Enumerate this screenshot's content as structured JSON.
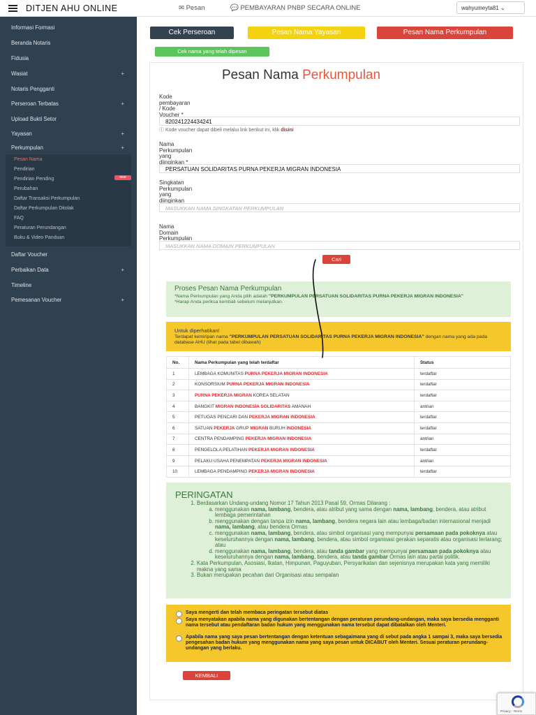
{
  "header": {
    "brand": "DITJEN AHU ONLINE",
    "pesan": "✉ Pesan",
    "pnbp": "💬 PEMBAYARAN PNBP SECARA ONLINE",
    "user": "wahyumeyta81 ⌄"
  },
  "sidebar": {
    "items": [
      {
        "label": "Informasi Formasi",
        "plus": ""
      },
      {
        "label": "Beranda Notaris",
        "plus": ""
      },
      {
        "label": "Fidusia",
        "plus": ""
      },
      {
        "label": "Wasiat",
        "plus": "+"
      },
      {
        "label": "Notaris Pengganti",
        "plus": ""
      },
      {
        "label": "Perseroan Terbatas",
        "plus": "+"
      },
      {
        "label": "Upload Bukti Setor",
        "plus": ""
      },
      {
        "label": "Yayasan",
        "plus": "+"
      },
      {
        "label": "Perkumpulan",
        "plus": "+"
      }
    ],
    "sub": [
      "Pesan Nama",
      "Pendirian",
      "Pendirian Pending",
      "Perubahan",
      "Daftar Transaksi Perkumpulan",
      "Daftar Perkumpulan Ditolak",
      "FAQ",
      "Peraturan Perundangan",
      "Buku & Video Panduan"
    ],
    "new_badge": "new",
    "bottom": [
      {
        "label": "Daftar Voucher",
        "plus": ""
      },
      {
        "label": "Perbaikan Data",
        "plus": "+"
      },
      {
        "label": "Timeline",
        "plus": ""
      },
      {
        "label": "Pemesanan Voucher",
        "plus": "+"
      }
    ]
  },
  "buttons": {
    "cek": "Cek Perseroan",
    "yayasan": "Pesan Nama Yayasan",
    "perkumpulan": "Pesan Nama Perkumpulan",
    "ceknama": "Cek nama yang telah dipesan",
    "cari": "Cari",
    "kembali": "KEMBALI"
  },
  "form": {
    "title_a": "Pesan Nama",
    "title_b": "Perkumpulan",
    "voucher_label": "Kode\npembayaran\n/ Kode\nVoucher *",
    "voucher_value": "820241224434241",
    "voucher_help": "Kode voucher dapat dibeli melalui link berikut ini, klik",
    "voucher_link": "disini",
    "nama_label": "Nama\nPerkumpulan\nyang\ndiinginkan *",
    "nama_value": "PERSATUAN SOLIDARITAS PURNA PEKERJA MIGRAN INDONESIA",
    "singkatan_label": "Singkatan\nPerkumpulan\nyang\ndiinginkan",
    "singkatan_placeholder": "MASUKKAN NAMA SINGKATAN PERKUMPULAN",
    "domain_label": "Nama\nDomain\nPerkumpulan",
    "domain_placeholder": "MASUKKAN NAMA DOMAIN PERKUMPULAN"
  },
  "proses": {
    "title": "Proses Pesan Nama Perkumpulan",
    "line1": "*Nama Perkumpulan yang Anda pilih adalah",
    "line1_name": "\"PERKUMPULAN PERSATUAN SOLIDARITAS PURNA PEKERJA MIGRAN INDONESIA\"",
    "line2": "*Harap Anda periksa kembali sebelum melanjutkan."
  },
  "perhatian": {
    "title": "Untuk diperhatikan!",
    "pre": "Terdapat kemiripan nama",
    "name": "\"PERKUMPULAN PERSATUAN SOLIDARITAS PURNA PEKERJA MIGRAN INDONESIA\"",
    "post": "dengan nama yang ada pada database AHU (lihat pada tabel dibawah)"
  },
  "table": {
    "headers": [
      "No.",
      "Nama Perkumpulan yang telah terdaftar",
      "Status"
    ],
    "rows": [
      {
        "no": "1",
        "parts": [
          [
            "LEMBAGA KOMUNITAS ",
            0
          ],
          [
            "PURNA PEKERJA MIGRAN INDONESIA",
            1
          ]
        ],
        "status": "terdaftar"
      },
      {
        "no": "2",
        "parts": [
          [
            "KONSORSIUM ",
            0
          ],
          [
            "PURNA PEKERJA MIGRAN INDONESIA",
            1
          ]
        ],
        "status": "terdaftar"
      },
      {
        "no": "3",
        "parts": [
          [
            "PURNA PEKERJA MIGRAN",
            1
          ],
          [
            " KOREA SELATAN",
            0
          ]
        ],
        "status": "terdaftar"
      },
      {
        "no": "4",
        "parts": [
          [
            "BANGKIT ",
            0
          ],
          [
            "MIGRAN INDONESIA SOLIDARITAS",
            1
          ],
          [
            " AMANAH",
            0
          ]
        ],
        "status": "antrian"
      },
      {
        "no": "5",
        "parts": [
          [
            "PETUGAS PENCARI DAN ",
            0
          ],
          [
            "PEKERJA MIGRAN INDONESIA",
            1
          ]
        ],
        "status": "terdaftar"
      },
      {
        "no": "6",
        "parts": [
          [
            "SATUAN ",
            0
          ],
          [
            "PEKERJA",
            1
          ],
          [
            " GRUP ",
            0
          ],
          [
            "MIGRAN",
            1
          ],
          [
            " BURUH ",
            0
          ],
          [
            "INDONESIA",
            1
          ]
        ],
        "status": "terdaftar"
      },
      {
        "no": "7",
        "parts": [
          [
            "CENTRA PENDAMPING ",
            0
          ],
          [
            "PEKERJA MIGRAN INDONESIA",
            1
          ]
        ],
        "status": "antrian"
      },
      {
        "no": "8",
        "parts": [
          [
            "PENGELOLA PELATIHAN ",
            0
          ],
          [
            "PEKERJA MIGRAN INDONESIA",
            1
          ]
        ],
        "status": "terdaftar"
      },
      {
        "no": "9",
        "parts": [
          [
            "PELAKU USAHA PENEMPATAN ",
            0
          ],
          [
            "PEKERJA MIGRAN INDONESIA",
            1
          ]
        ],
        "status": "antrian"
      },
      {
        "no": "10",
        "parts": [
          [
            "LEMBAGA PENDAMPING ",
            0
          ],
          [
            "PEKERJA MIGRAN INDONESIA",
            1
          ]
        ],
        "status": "terdaftar"
      }
    ]
  },
  "peringatan": {
    "title": "PERINGATAN",
    "items": [
      {
        "html": "Berdasarkan Undang-undang Nomor 17 Tahun 2013 Pasal 59, Ormas Dilarang :",
        "sub": [
          "menggunakan <b>nama, lambang</b>, bendera, atau atribut yang sama dengan <b>nama, lambang</b>, bendera, atau atribut lembaga pemerintahan",
          "menggunakan dengan tanpa izin <b>nama, lambang</b>, bendera negara lain atau lembaga/badan internasional menjadi <b>nama, lambang</b>, atau bendera Ormas",
          "menggunakan <b>nama, lambang</b>, bendera, atau simbol organisasi yang mempunyai <b>persamaan pada pokoknya</b> atau keseluruhannya dengan <b>nama, lambang</b>, bendera, atau simbol organisasi gerakan separatis atau organisasi terlarang; atau",
          "menggunakan <b>nama, lambang</b>, bendera, atau <b>tanda gambar</b> yang mempunyai <b>persamaan pada pokoknya</b> atau keseluruhannya dengan <b>nama, lambang</b>, bendera, atau <b>tanda gambar</b> Ormas lain atau partai politik."
        ]
      },
      {
        "html": "Kata Perkumpulan, Asosiasi, Ikatan, Himpunan, Paguyuban, Persyarikatan dan sejenisnya merupakan kata yang memiliki makna yang sama",
        "sub": []
      },
      {
        "html": "Bukan merupakan pecahan dari Organisasi atau sempalan",
        "sub": []
      }
    ]
  },
  "agreements": [
    "Saya mengerti dan telah membaca peringatan tersebut diatas",
    "Saya menyatakan apabila nama yang digunakan bertentangan dengan peraturan perundang-undangan, maka saya bersedia mengganti nama tersebut atau pendaftaran badan hukum yang menggunakan nama tersebut dapat dibatalkan oleh Menteri.",
    "Apabila nama yang saya pesan bertentangan dengan ketentuan sebagaimana yang di sebut pada angka 1 sampai 3, maka saya bersedia pengesahan badan hukum yang menggunakan nama yang saya pesan untuk DICABUT oleh Menteri. Sesuai peraturan perundang-undangan yang berlaku."
  ],
  "recaptcha": {
    "text": "Privacy - Terms"
  }
}
